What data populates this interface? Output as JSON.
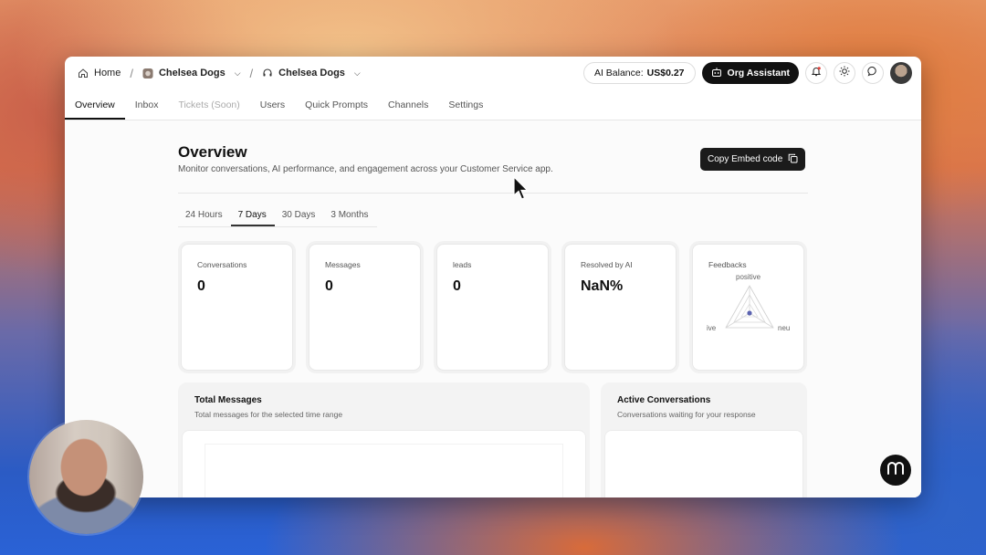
{
  "breadcrumb": {
    "home": "Home",
    "org": "Chelsea Dogs",
    "app": "Chelsea Dogs"
  },
  "topbar": {
    "balance_label": "AI Balance:",
    "balance_amount": "US$0.27",
    "assistant_label": "Org Assistant"
  },
  "nav_tabs": [
    "Overview",
    "Inbox",
    "Tickets (Soon)",
    "Users",
    "Quick Prompts",
    "Channels",
    "Settings"
  ],
  "page": {
    "title": "Overview",
    "subtitle": "Monitor conversations, AI performance, and engagement across your Customer Service app.",
    "embed_button": "Copy Embed code"
  },
  "range_tabs": [
    "24 Hours",
    "7 Days",
    "30 Days",
    "3 Months"
  ],
  "stats": [
    {
      "label": "Conversations",
      "value": "0"
    },
    {
      "label": "Messages",
      "value": "0"
    },
    {
      "label": "leads",
      "value": "0"
    },
    {
      "label": "Resolved by AI",
      "value": "NaN%"
    }
  ],
  "feedbacks": {
    "label": "Feedbacks",
    "axis_positive": "positive",
    "axis_left": "ive",
    "axis_right": "neu"
  },
  "panels": {
    "total_title": "Total Messages",
    "total_sub": "Total messages for the selected time range",
    "active_title": "Active Conversations",
    "active_sub": "Conversations waiting for your response"
  },
  "colors": {
    "accent_dark": "#111111",
    "radar_dot": "#5b63b0"
  }
}
